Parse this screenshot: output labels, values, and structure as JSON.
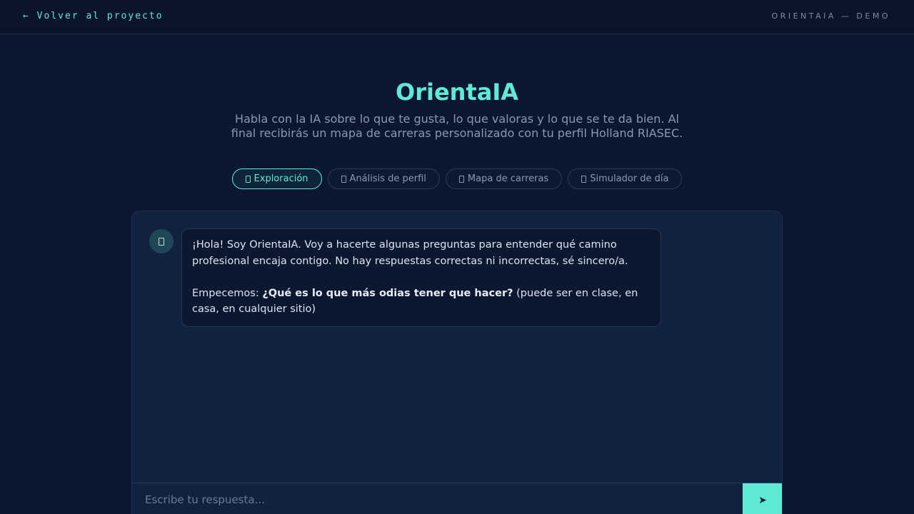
{
  "topbar": {
    "back_label": "← Volver al proyecto",
    "brand_tag": "ORIENTAIA — DEMO"
  },
  "header": {
    "title": "OrientaIA",
    "subtitle": "Habla con la IA sobre lo que te gusta, lo que valoras y lo que se te da bien. Al final recibirás un mapa de carreras personalizado con tu perfil Holland RIASEC."
  },
  "tabs": [
    {
      "label": "Exploración",
      "icon": "tab-icon",
      "active": true
    },
    {
      "label": "Análisis de perfil",
      "icon": "tab-icon",
      "active": false
    },
    {
      "label": "Mapa de carreras",
      "icon": "tab-icon",
      "active": false
    },
    {
      "label": "Simulador de día",
      "icon": "tab-icon",
      "active": false
    }
  ],
  "chat": {
    "messages": [
      {
        "sender": "bot",
        "avatar_icon": "bot-icon",
        "paragraph_1": "¡Hola! Soy OrientaIA. Voy a hacerte algunas preguntas para entender qué camino profesional encaja contigo. No hay respuestas correctas ni incorrectas, sé sincero/a.",
        "paragraph_2_lead": "Empecemos: ",
        "paragraph_2_bold": "¿Qué es lo que más odias tener que hacer?",
        "paragraph_2_tail": " (puede ser en clase, en casa, en cualquier sitio)"
      }
    ],
    "input_placeholder": "Escribe tu respuesta...",
    "input_value": "",
    "send_icon": "send-arrow-icon",
    "send_glyph": "➤"
  },
  "colors": {
    "background": "#0b1730",
    "accent": "#5eead4",
    "panel": "#12213f",
    "bubble": "#0b1830",
    "muted_text": "#8a98b2"
  }
}
